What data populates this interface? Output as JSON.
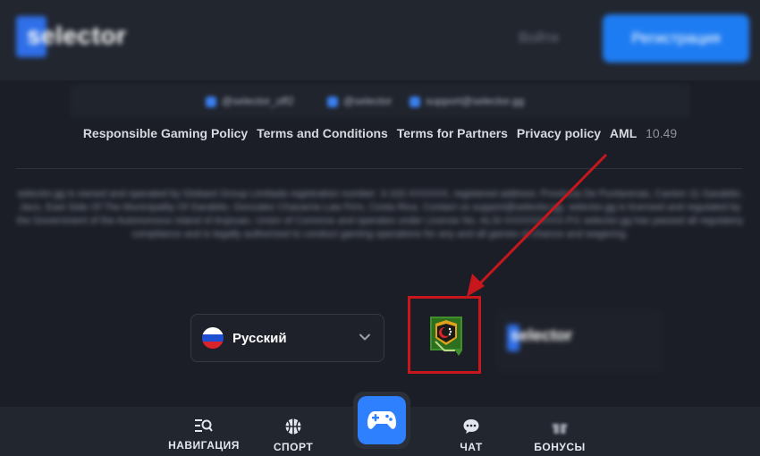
{
  "header": {
    "logo_text": "selector",
    "login_label": "Войти",
    "register_label": "Регистрация"
  },
  "contacts": [
    {
      "icon": "telegram-icon",
      "text": "@selector_off2"
    },
    {
      "icon": "telegram-icon",
      "text": "@selector"
    },
    {
      "icon": "mail-icon",
      "text": "support@selector.gg"
    }
  ],
  "footer_links": {
    "responsible": "Responsible Gaming Policy",
    "terms": "Terms and Conditions",
    "partners": "Terms for Partners",
    "privacy": "Privacy policy",
    "aml": "AML",
    "version": "10.49"
  },
  "legal_text": "selector.gg is owned and operated by Globant Group Limitada registration number: 3-102-XXXXXX, registered address: Provincia De Puntarenas, Canton 11 Garabito, Jaco, East Side Of The Municipality Of Garabito, Gonzalez Chavarria Law Firm, Costa Rica. Contact us support@selector.gg. selector.gg is licensed and regulated by the Government of the Autonomous Island of Anjouan, Union of Comoros and operates under License No. ALSI-XXXXXXXXX-FI1 selector.gg has passed all regulatory compliance and is legally authorized to conduct gaming operations for any and all games of chance and wagering.",
  "language": {
    "label": "Русский",
    "flag": "russia-flag-icon"
  },
  "footer_logo_text": "selector",
  "bottom_nav": {
    "navigation": "НАВИГАЦИЯ",
    "sport": "СПОРТ",
    "chat": "ЧАТ",
    "bonuses": "БОНУСЫ"
  },
  "colors": {
    "background": "#1b1e27",
    "accent": "#1e7cf2",
    "highlight": "#c8161d"
  }
}
